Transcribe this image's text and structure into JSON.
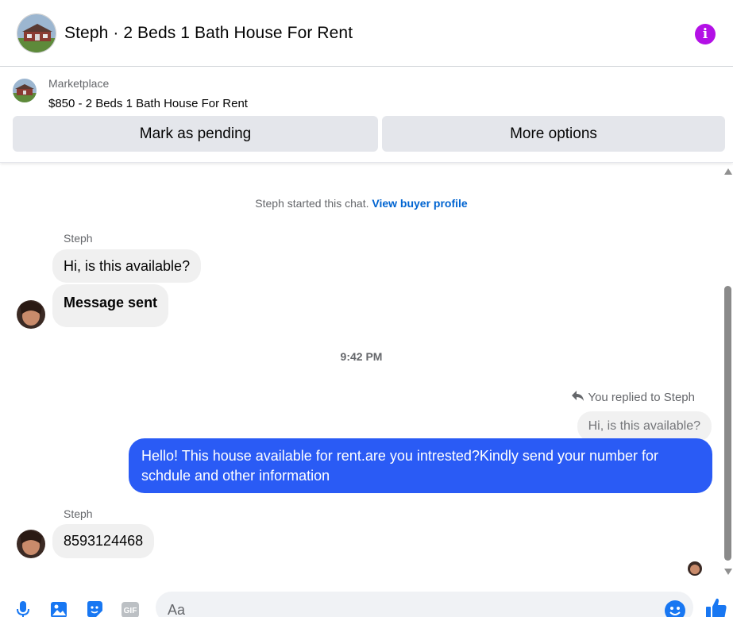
{
  "header": {
    "title": "Steph · 2 Beds 1 Bath House For Rent",
    "info_icon": "info-icon",
    "accent_color": "#b310e6"
  },
  "listing": {
    "source": "Marketplace",
    "title": "$850 - 2 Beds 1 Bath House For Rent",
    "mark_pending_label": "Mark as pending",
    "more_options_label": "More options"
  },
  "conversation": {
    "started_text": "Steph started this chat.",
    "view_profile_link": "View buyer profile",
    "sender_name": "Steph",
    "messages_in": [
      {
        "text": "Hi, is this available?"
      },
      {
        "text": "Message sent"
      }
    ],
    "timestamp": "9:42 PM",
    "reply_note": "You replied to Steph",
    "quoted_text": "Hi, is this available?",
    "own_message": "Hello! This house available for rent.are you intrested?Kindly send your number for schdule and other information",
    "own_bubble_color": "#2a5bf5",
    "second_sender_name": "Steph",
    "reply_in": "8593124468"
  },
  "composer": {
    "placeholder": "Aa",
    "icons": [
      "microphone-icon",
      "photo-icon",
      "sticker-icon",
      "gif-icon",
      "emoji-icon",
      "thumbs-up-icon"
    ],
    "gif_label": "GIF",
    "accent_color": "#1877f2"
  }
}
